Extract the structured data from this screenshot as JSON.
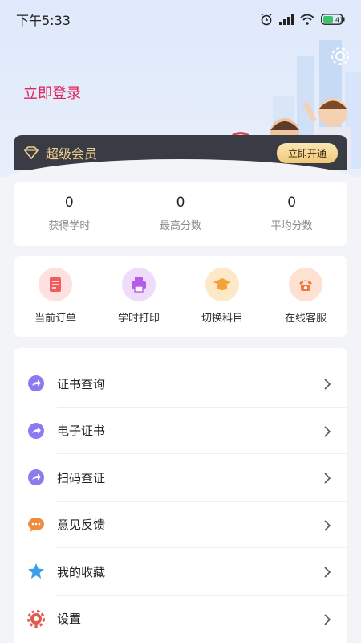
{
  "status_bar": {
    "time": "下午5:33",
    "battery": "41"
  },
  "header": {
    "login_text": "立即登录"
  },
  "vip": {
    "label": "超级会员",
    "button": "立即开通"
  },
  "stats": [
    {
      "value": "0",
      "label": "获得学时"
    },
    {
      "value": "0",
      "label": "最高分数"
    },
    {
      "value": "0",
      "label": "平均分数"
    }
  ],
  "quick_actions": [
    {
      "label": "当前订单",
      "icon": "order-icon",
      "color": "#f25b5b"
    },
    {
      "label": "学时打印",
      "icon": "printer-icon",
      "color": "#b45ce8"
    },
    {
      "label": "切换科目",
      "icon": "graduation-cap-icon",
      "color": "#f2a23a"
    },
    {
      "label": "在线客服",
      "icon": "phone-icon",
      "color": "#f07a3c"
    }
  ],
  "menu": [
    {
      "label": "证书查询",
      "icon": "share-arrow-icon"
    },
    {
      "label": "电子证书",
      "icon": "share-arrow-icon"
    },
    {
      "label": "扫码查证",
      "icon": "share-arrow-icon"
    },
    {
      "label": "意见反馈",
      "icon": "chat-bubble-icon"
    },
    {
      "label": "我的收藏",
      "icon": "star-icon"
    },
    {
      "label": "设置",
      "icon": "gear-icon"
    }
  ],
  "colors": {
    "accent_login": "#e0245e",
    "vip_gold": "#f2cf8d",
    "menu_purple": "#8a7bf0"
  }
}
